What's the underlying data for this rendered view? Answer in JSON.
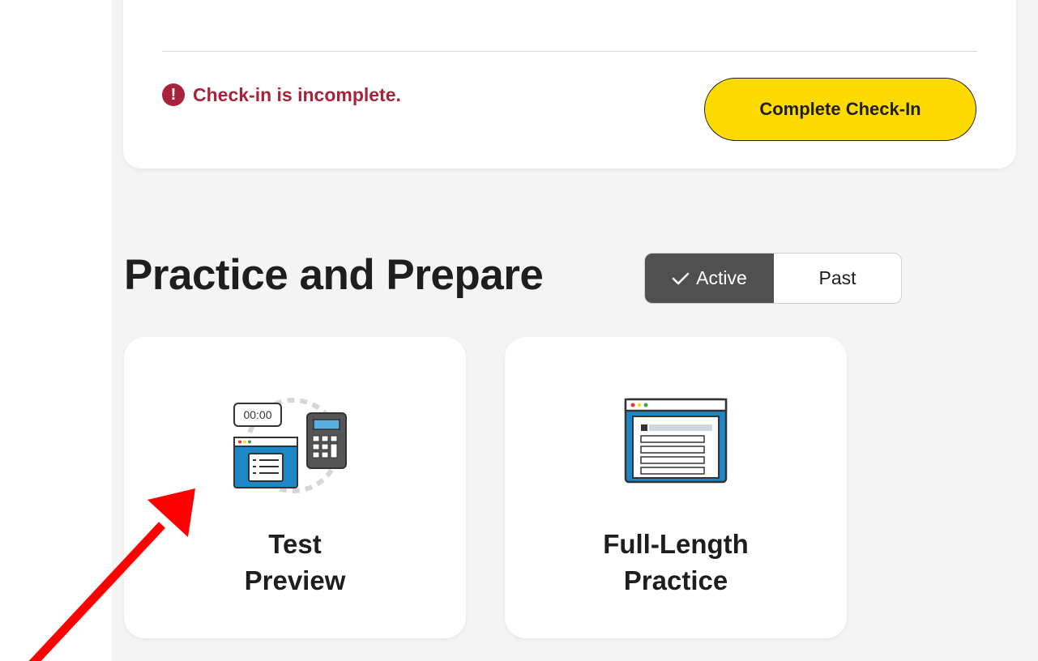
{
  "checkin": {
    "status_text": "Check-in is incomplete.",
    "alert_icon_glyph": "!",
    "button_label": "Complete Check-In",
    "status_color": "#a8233a",
    "button_color": "#fedb00"
  },
  "practice": {
    "title": "Practice and Prepare",
    "toggle": {
      "active_label": "Active",
      "past_label": "Past",
      "selected": "Active"
    },
    "cards": [
      {
        "line1": "Test",
        "line2": "Preview",
        "icon": "timer-calculator-browser-icon",
        "timer_text": "00:00"
      },
      {
        "line1": "Full-Length",
        "line2": "Practice",
        "icon": "browser-form-icon"
      }
    ]
  },
  "annotation": {
    "arrow_color": "#ff0000",
    "points_to": "Test Preview"
  }
}
